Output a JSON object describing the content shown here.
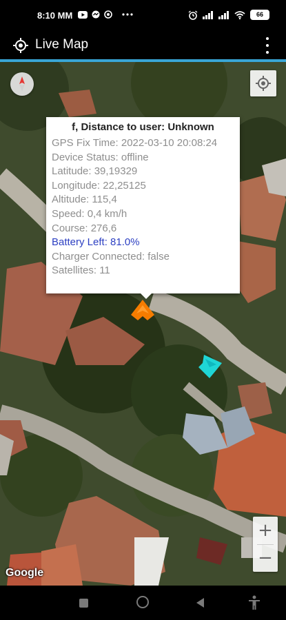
{
  "status_bar": {
    "time": "8:10 MM",
    "battery": "66",
    "left_icons": [
      "youtube-icon",
      "messenger-icon",
      "notification-icon",
      "more-icon"
    ],
    "right_icons": [
      "alarm-icon",
      "signal-icon",
      "signal-icon",
      "wifi-icon",
      "battery-icon"
    ]
  },
  "app_bar": {
    "title": "Live Map",
    "logo_icon": "crosshair-icon",
    "menu_icon": "overflow-menu-icon"
  },
  "accent_color": "#39a6d6",
  "map": {
    "compass_icon": "compass-icon",
    "locate_icon": "my-location-icon",
    "attribution": "Google",
    "zoom_in": "+",
    "zoom_out": "−",
    "info_window": {
      "title": "f, Distance to user: Unknown",
      "lines": [
        {
          "text": "GPS Fix Time: 2022-03-10 20:08:24",
          "color": "#8e8e8e"
        },
        {
          "text": "Device Status: offline",
          "color": "#8e8e8e"
        },
        {
          "text": "Latitude: 39,19329",
          "color": "#8e8e8e"
        },
        {
          "text": "Longitude: 22,25125",
          "color": "#8e8e8e"
        },
        {
          "text": "Altitude: 115,4",
          "color": "#8e8e8e"
        },
        {
          "text": "Speed: 0,4 km/h",
          "color": "#8e8e8e"
        },
        {
          "text": "Course: 276,6",
          "color": "#8e8e8e"
        },
        {
          "text": "Battery Left: 81.0%",
          "color": "#2c3fc2"
        },
        {
          "text": "Charger Connected: false",
          "color": "#8e8e8e"
        },
        {
          "text": "Satellites: 11",
          "color": "#8e8e8e"
        }
      ]
    },
    "markers": [
      {
        "name": "orange-marker",
        "color": "#f57c00"
      },
      {
        "name": "cyan-marker",
        "color": "#1fd6d6"
      }
    ]
  },
  "nav_bar": {
    "icons": [
      "recents-icon",
      "home-icon",
      "back-icon",
      "accessibility-icon"
    ]
  }
}
